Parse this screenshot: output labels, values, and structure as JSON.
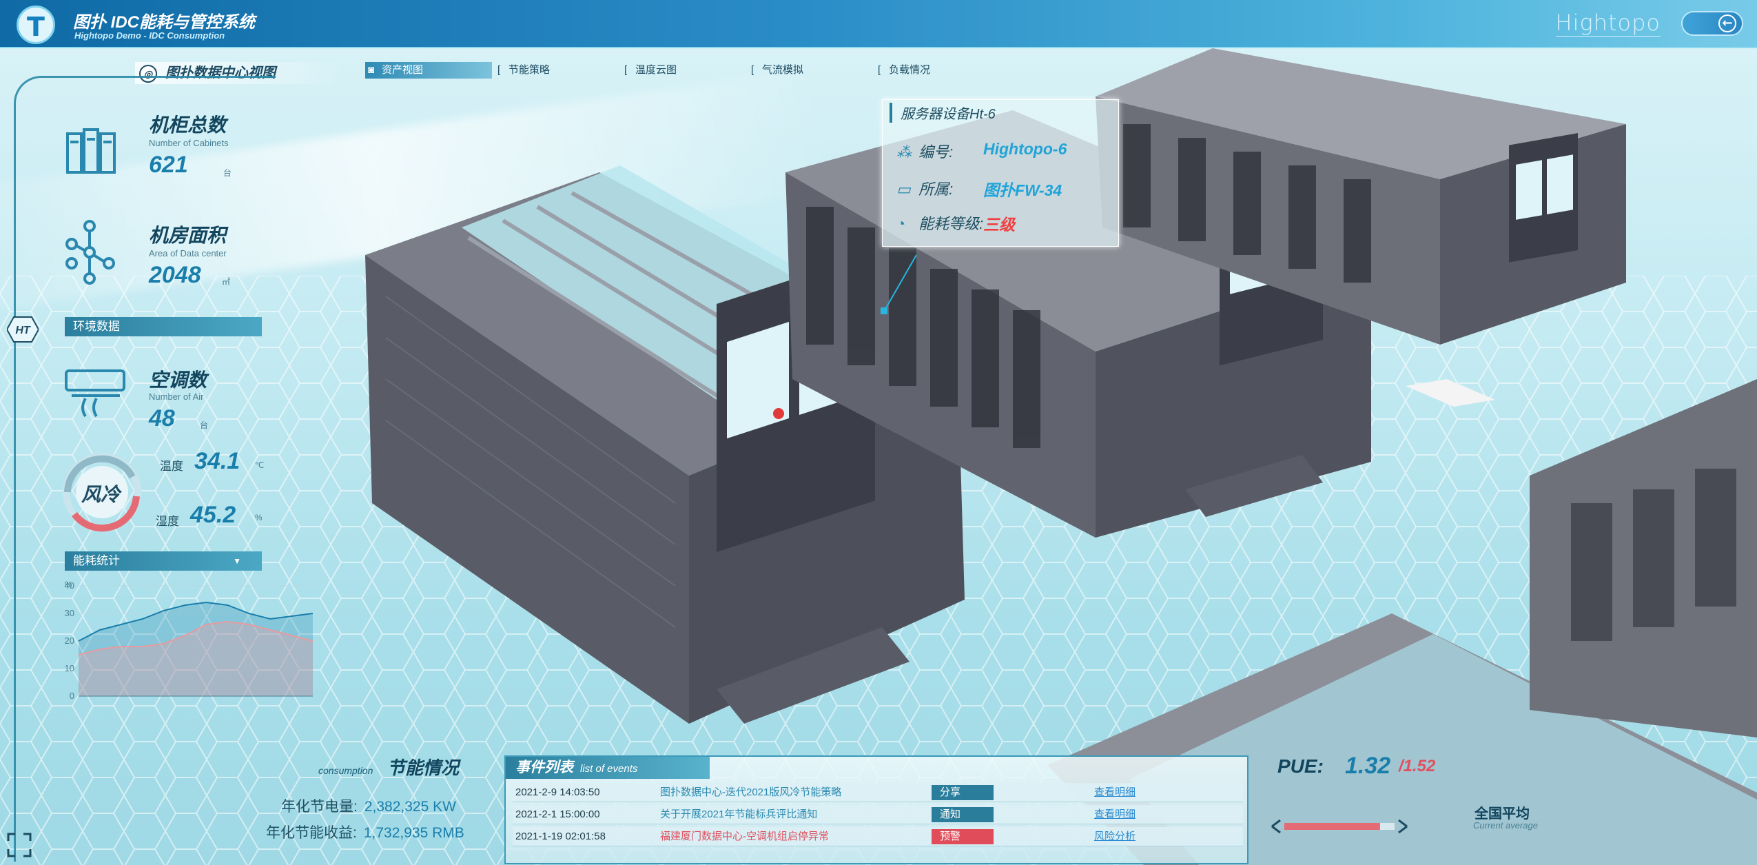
{
  "header": {
    "title": "图扑 IDC能耗与管控系统",
    "subtitle": "Hightopo Demo - IDC Consumption",
    "brand": "Hightopo",
    "back_icon": "back-arrow-icon"
  },
  "nav": {
    "view_title": "图扑数据中心视图",
    "tabs": [
      {
        "label": "资产视图",
        "active": true
      },
      {
        "label": "节能策略",
        "active": false
      },
      {
        "label": "温度云图",
        "active": false
      },
      {
        "label": "气流模拟",
        "active": false
      },
      {
        "label": "负载情况",
        "active": false
      }
    ]
  },
  "stats": {
    "cabinets": {
      "title": "机柜总数",
      "en": "Number of Cabinets",
      "value": "621",
      "unit": "台"
    },
    "area": {
      "title": "机房面积",
      "en": "Area of Data center",
      "value": "2048",
      "unit": "㎡"
    },
    "env_section": "环境数据",
    "air": {
      "title": "空调数",
      "en": "Number of Air",
      "value": "48",
      "unit": "台"
    },
    "mode": "风冷",
    "temperature": {
      "label": "温度",
      "value": "34.1",
      "unit": "℃"
    },
    "humidity": {
      "label": "湿度",
      "value": "45.2",
      "unit": "%"
    },
    "energy_section": "能耗统计"
  },
  "side": {
    "ht_label": "HT"
  },
  "chart_data": {
    "type": "area",
    "title": "",
    "ylabel": "%",
    "yticks": [
      "40",
      "30",
      "20",
      "10",
      "0"
    ],
    "ylim": [
      0,
      40
    ],
    "series": [
      {
        "values": [
          20,
          24,
          26,
          28,
          31,
          33,
          34,
          33,
          30,
          28,
          29,
          30
        ]
      },
      {
        "values": [
          15,
          17,
          18,
          18,
          19,
          22,
          26,
          27,
          26,
          24,
          22,
          20
        ]
      }
    ],
    "colors": [
      "#1a7eab",
      "#e89aa0"
    ]
  },
  "savings": {
    "title": "节能情况",
    "en": "consumption",
    "rows": [
      {
        "label": "年化节电量:",
        "value": "2,382,325 KW"
      },
      {
        "label": "年化节能收益:",
        "value": "1,732,935 RMB"
      }
    ]
  },
  "events": {
    "title": "事件列表",
    "en": "list of events",
    "rows": [
      {
        "date": "2021-2-9 14:03:50",
        "text": "图扑数据中心-迭代2021版风冷节能策略",
        "tag": "分享",
        "link": "查看明细",
        "alert": false
      },
      {
        "date": "2021-2-1 15:00:00",
        "text": "关于开展2021年节能标兵评比通知",
        "tag": "通知",
        "link": "查看明细",
        "alert": false
      },
      {
        "date": "2021-1-19 02:01:58",
        "text": "福建厦门数据中心-空调机组启停异常",
        "tag": "预警",
        "link": "风险分析",
        "alert": true
      }
    ]
  },
  "pue": {
    "label": "PUE:",
    "value": "1.32",
    "max": "/1.52",
    "avg_label": "全国平均",
    "avg_en": "Current average"
  },
  "popup": {
    "title": "服务器设备Ht-6",
    "rows": [
      {
        "label": "编号:",
        "value": "Hightopo-6",
        "icon": "nodes-icon"
      },
      {
        "label": "所属:",
        "value": "图扑FW-34",
        "icon": "book-icon"
      },
      {
        "label": "能耗等级:",
        "value": "三级",
        "icon": "gauge-icon"
      }
    ]
  }
}
